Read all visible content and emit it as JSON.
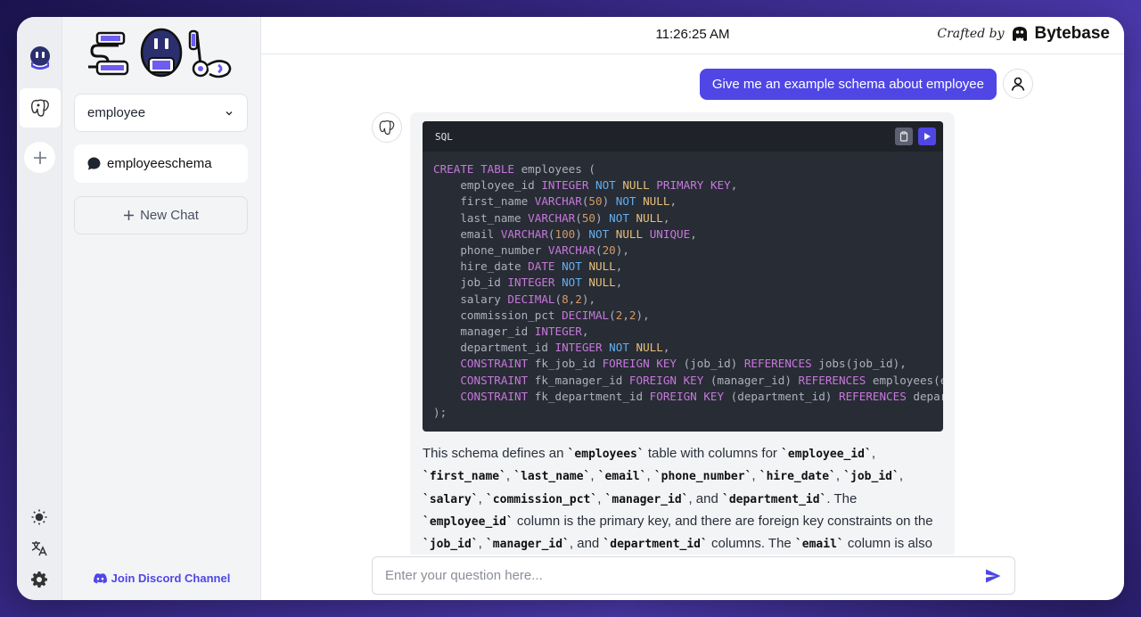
{
  "header": {
    "clock": "11:26:25 AM",
    "crafted_label": "Crafted by",
    "brand": "Bytebase"
  },
  "sidebar": {
    "database_select": {
      "value": "employee"
    },
    "conversations": [
      {
        "label": "employeeschema"
      }
    ],
    "new_chat_label": "New Chat",
    "discord_label": "Join Discord Channel"
  },
  "chat": {
    "user_message": "Give me an example schema about employee",
    "code": {
      "language": "SQL",
      "lines": [
        "CREATE TABLE employees (",
        "    employee_id INTEGER NOT NULL PRIMARY KEY,",
        "    first_name VARCHAR(50) NOT NULL,",
        "    last_name VARCHAR(50) NOT NULL,",
        "    email VARCHAR(100) NOT NULL UNIQUE,",
        "    phone_number VARCHAR(20),",
        "    hire_date DATE NOT NULL,",
        "    job_id INTEGER NOT NULL,",
        "    salary DECIMAL(8,2),",
        "    commission_pct DECIMAL(2,2),",
        "    manager_id INTEGER,",
        "    department_id INTEGER NOT NULL,",
        "    CONSTRAINT fk_job_id FOREIGN KEY (job_id) REFERENCES jobs(job_id),",
        "    CONSTRAINT fk_manager_id FOREIGN KEY (manager_id) REFERENCES employees(emp",
        "    CONSTRAINT fk_department_id FOREIGN KEY (department_id) REFERENCES departm",
        ");"
      ]
    },
    "explanation": [
      {
        "t": "This schema defines an "
      },
      {
        "c": "`employees`"
      },
      {
        "t": " table with columns for "
      },
      {
        "c": "`employee_id`"
      },
      {
        "t": ", "
      },
      {
        "c": "`first_name`"
      },
      {
        "t": ", "
      },
      {
        "c": "`last_name`"
      },
      {
        "t": ", "
      },
      {
        "c": "`email`"
      },
      {
        "t": ", "
      },
      {
        "c": "`phone_number`"
      },
      {
        "t": ", "
      },
      {
        "c": "`hire_date`"
      },
      {
        "t": ", "
      },
      {
        "c": "`job_id`"
      },
      {
        "t": ", "
      },
      {
        "c": "`salary`"
      },
      {
        "t": ", "
      },
      {
        "c": "`commission_pct`"
      },
      {
        "t": ", "
      },
      {
        "c": "`manager_id`"
      },
      {
        "t": ", and "
      },
      {
        "c": "`department_id`"
      },
      {
        "t": ". The "
      },
      {
        "c": "`employee_id`"
      },
      {
        "t": " column is the primary key, and there are foreign key constraints on the "
      },
      {
        "c": "`job_id`"
      },
      {
        "t": ", "
      },
      {
        "c": "`manager_id`"
      },
      {
        "t": ", and "
      },
      {
        "c": "`department_id`"
      },
      {
        "t": " columns. The "
      },
      {
        "c": "`email`"
      },
      {
        "t": " column is also set to be unique."
      }
    ]
  },
  "input": {
    "placeholder": "Enter your question here..."
  },
  "colors": {
    "accent": "#4f46e5",
    "discord": "#4f46e5",
    "code_bg": "#282c34"
  }
}
